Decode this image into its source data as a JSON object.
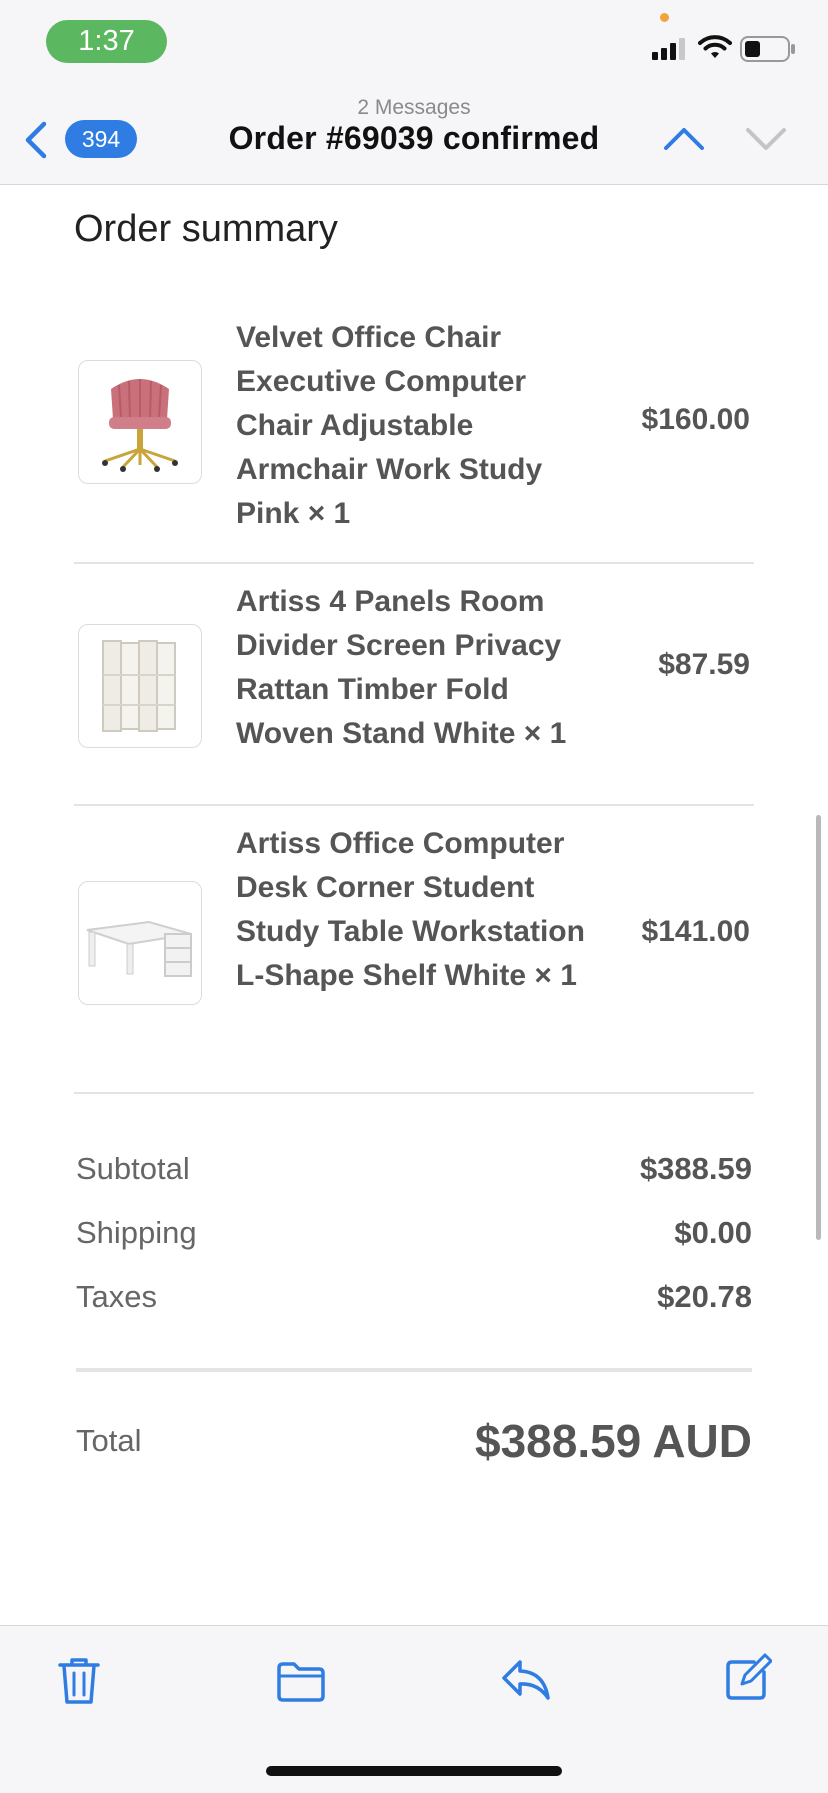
{
  "status_bar": {
    "time": "1:37"
  },
  "nav": {
    "back_count": "394",
    "message_count": "2 Messages",
    "subject": "Order #69039 confirmed"
  },
  "summary": {
    "title": "Order summary",
    "items": [
      {
        "name": "Velvet Office Chair Executive Computer Chair Adjustable Armchair Work Study Pink × 1",
        "price": "$160.00",
        "thumb_icon": "pink-office-chair"
      },
      {
        "name": "Artiss 4 Panels Room Divider Screen Privacy Rattan Timber Fold Woven Stand White × 1",
        "price": "$87.59",
        "thumb_icon": "room-divider-screen"
      },
      {
        "name": "Artiss Office Computer Desk Corner Student Study Table Workstation L-Shape Shelf White × 1",
        "price": "$141.00",
        "thumb_icon": "l-shape-desk"
      }
    ],
    "subtotal_label": "Subtotal",
    "subtotal_value": "$388.59",
    "shipping_label": "Shipping",
    "shipping_value": "$0.00",
    "taxes_label": "Taxes",
    "taxes_value": "$20.78",
    "total_label": "Total",
    "total_value": "$388.59 AUD"
  },
  "toolbar": {
    "icons": [
      "trash-icon",
      "folder-icon",
      "reply-icon",
      "compose-icon"
    ]
  },
  "colors": {
    "accent": "#2f7de2",
    "time_pill": "#5cb860",
    "text": "#555555",
    "bar_background": "#f6f6f8"
  }
}
